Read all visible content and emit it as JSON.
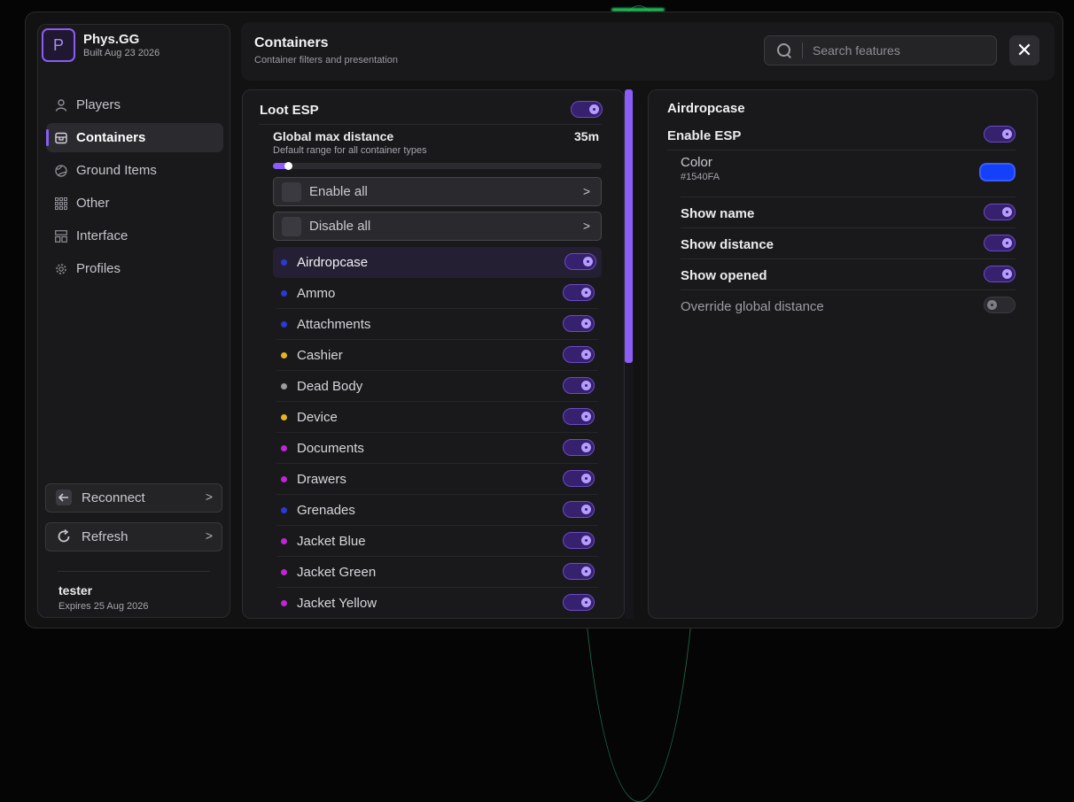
{
  "brand": {
    "logo_letter": "P",
    "name": "Phys.GG",
    "build": "Built Aug 23 2026"
  },
  "sidebar": {
    "items": [
      {
        "label": "Players",
        "icon": "person-icon",
        "active": false
      },
      {
        "label": "Containers",
        "icon": "box-icon",
        "active": true
      },
      {
        "label": "Ground Items",
        "icon": "globe-icon",
        "active": false
      },
      {
        "label": "Other",
        "icon": "grid-icon",
        "active": false
      },
      {
        "label": "Interface",
        "icon": "layout-icon",
        "active": false
      },
      {
        "label": "Profiles",
        "icon": "gear-icon",
        "active": false
      }
    ],
    "reconnect_label": "Reconnect",
    "refresh_label": "Refresh",
    "user": {
      "name": "tester",
      "expires": "Expires 25 Aug 2026"
    }
  },
  "header": {
    "title": "Containers",
    "subtitle": "Container filters and presentation",
    "search_placeholder": "Search features",
    "close_glyph": "✕"
  },
  "loot": {
    "title": "Loot ESP",
    "enabled": true,
    "global_max_distance": {
      "label": "Global max distance",
      "value_text": "35m",
      "description": "Default range for all container types",
      "fraction": 0.04
    },
    "enable_all_label": "Enable all",
    "disable_all_label": "Disable all",
    "chevron": ">",
    "items": [
      {
        "label": "Airdropcase",
        "color": "#2a3ad6",
        "enabled": true,
        "selected": true
      },
      {
        "label": "Ammo",
        "color": "#2a3ad6",
        "enabled": true
      },
      {
        "label": "Attachments",
        "color": "#2a3ad6",
        "enabled": true
      },
      {
        "label": "Cashier",
        "color": "#e6b422",
        "enabled": true
      },
      {
        "label": "Dead Body",
        "color": "#9a9aa0",
        "enabled": true
      },
      {
        "label": "Device",
        "color": "#e6b422",
        "enabled": true
      },
      {
        "label": "Documents",
        "color": "#c026d3",
        "enabled": true
      },
      {
        "label": "Drawers",
        "color": "#c026d3",
        "enabled": true
      },
      {
        "label": "Grenades",
        "color": "#2a3ad6",
        "enabled": true
      },
      {
        "label": "Jacket Blue",
        "color": "#c026d3",
        "enabled": true
      },
      {
        "label": "Jacket Green",
        "color": "#c026d3",
        "enabled": true
      },
      {
        "label": "Jacket Yellow",
        "color": "#c026d3",
        "enabled": true
      }
    ]
  },
  "detail": {
    "title": "Airdropcase",
    "enable_esp_label": "Enable ESP",
    "enable_esp": true,
    "color_label": "Color",
    "color_hex": "#1540FA",
    "show_name_label": "Show name",
    "show_name": true,
    "show_distance_label": "Show distance",
    "show_distance": true,
    "show_opened_label": "Show opened",
    "show_opened": true,
    "override_label": "Override global distance",
    "override": false
  },
  "theme": {
    "accent": "#8b5cf6",
    "background": "#121212",
    "panel": "#19191b"
  }
}
